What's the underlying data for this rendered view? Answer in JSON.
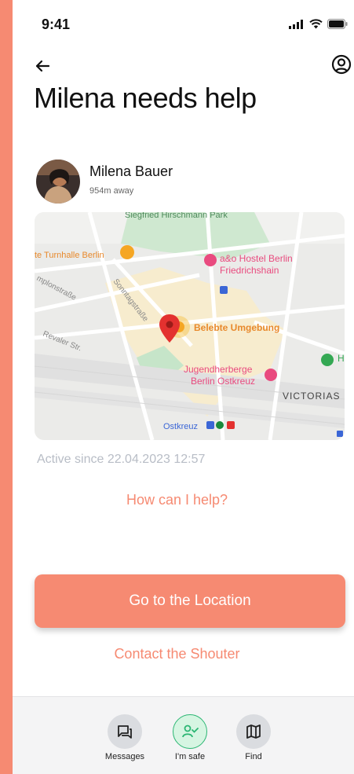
{
  "status": {
    "time": "9:41"
  },
  "header": {
    "title": "Milena needs help"
  },
  "user": {
    "name": "Milena Bauer",
    "distance": "954m away"
  },
  "map": {
    "labels": {
      "park": "Siegfried Hirschmann Park",
      "turnhalle": "te Turnhalle Berlin",
      "hostel1": "a&o Hostel Berlin",
      "hostel1b": "Friedrichshain",
      "belebte": "Belebte Umgebung",
      "jugend1": "Jugendherberge",
      "jugend2": "Berlin Ostkreuz",
      "victoria": "VICTORIAS",
      "ostkreuz": "Ostkreuz",
      "street1": "mplonstraße",
      "street2": "Sonntagstraße",
      "street3": "Revaler Str."
    }
  },
  "active_since": "Active since 22.04.2023 12:57",
  "help_link": "How can I help?",
  "primary_button": "Go to the Location",
  "secondary_button": "Contact the Shouter",
  "bottom_nav": [
    {
      "label": "Messages",
      "icon": "messages-icon"
    },
    {
      "label": "I'm safe",
      "icon": "user-check-icon"
    },
    {
      "label": "Find",
      "icon": "map-icon"
    }
  ],
  "colors": {
    "accent": "#F68A72",
    "safe_green": "#2BB673"
  }
}
